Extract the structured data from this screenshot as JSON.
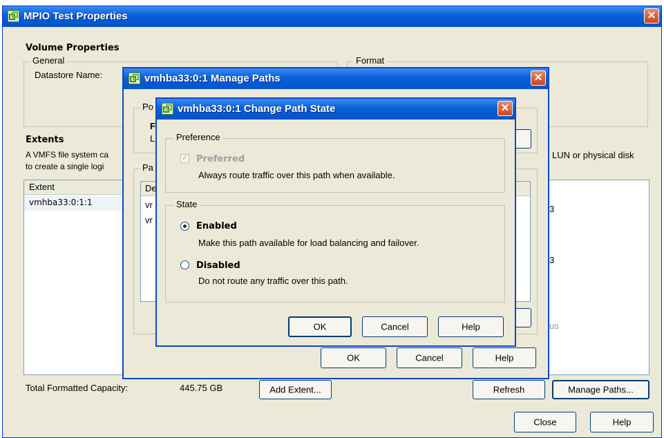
{
  "main_window": {
    "title": "MPIO Test Properties",
    "close_glyph": "✕",
    "volume_properties_heading": "Volume Properties",
    "general_legend": "General",
    "datastore_name_label": "Datastore Name:",
    "format_legend": "Format",
    "extents_heading": "Extents",
    "extents_desc_line1": "A VMFS file system ca",
    "extents_desc_line2": "to create a single logi",
    "extents_desc_right": "LUN or physical disk",
    "extent_column_header": "Extent",
    "extent_rows": [
      "vmhba33:0:1:1"
    ],
    "total_capacity_label": "Total Formatted Capacity:",
    "total_capacity_value": "445.75 GB",
    "add_extent_button": "Add Extent...",
    "refresh_button": "Refresh",
    "manage_paths_button": "Manage Paths...",
    "close_button": "Close",
    "help_button": "Help"
  },
  "manage_paths_dialog": {
    "title": "vmhba33:0:1 Manage Paths",
    "close_glyph": "✕",
    "policy_legend_partial": "Po",
    "policy_line1_partial": "F",
    "policy_line2_partial": "L",
    "paths_legend_partial": "Pa",
    "paths_column_partial": "De",
    "path_rows_partial": [
      "vr",
      "vr"
    ],
    "ok_button": "OK",
    "cancel_button": "Cancel",
    "help_button": "Help"
  },
  "change_path_state_dialog": {
    "title": "vmhba33:0:1 Change Path State",
    "close_glyph": "✕",
    "preference_legend": "Preference",
    "preferred_label": "Preferred",
    "preferred_checked": true,
    "preferred_description": "Always route traffic over this path when available.",
    "state_legend": "State",
    "enabled_label": "Enabled",
    "enabled_description": "Make this path available for load balancing and failover.",
    "enabled_selected": true,
    "disabled_label": "Disabled",
    "disabled_description": "Do not route any traffic over this path.",
    "ok_button": "OK",
    "cancel_button": "Cancel",
    "help_button": "Help"
  },
  "colors": {
    "title_bar_blue": "#0a5fd8",
    "window_face": "#ece9d8",
    "close_red": "#c9441b",
    "disabled_text": "#a0a0a0"
  },
  "icons": {
    "app": "vmware-chain-icon",
    "check": "check-mark-icon"
  }
}
